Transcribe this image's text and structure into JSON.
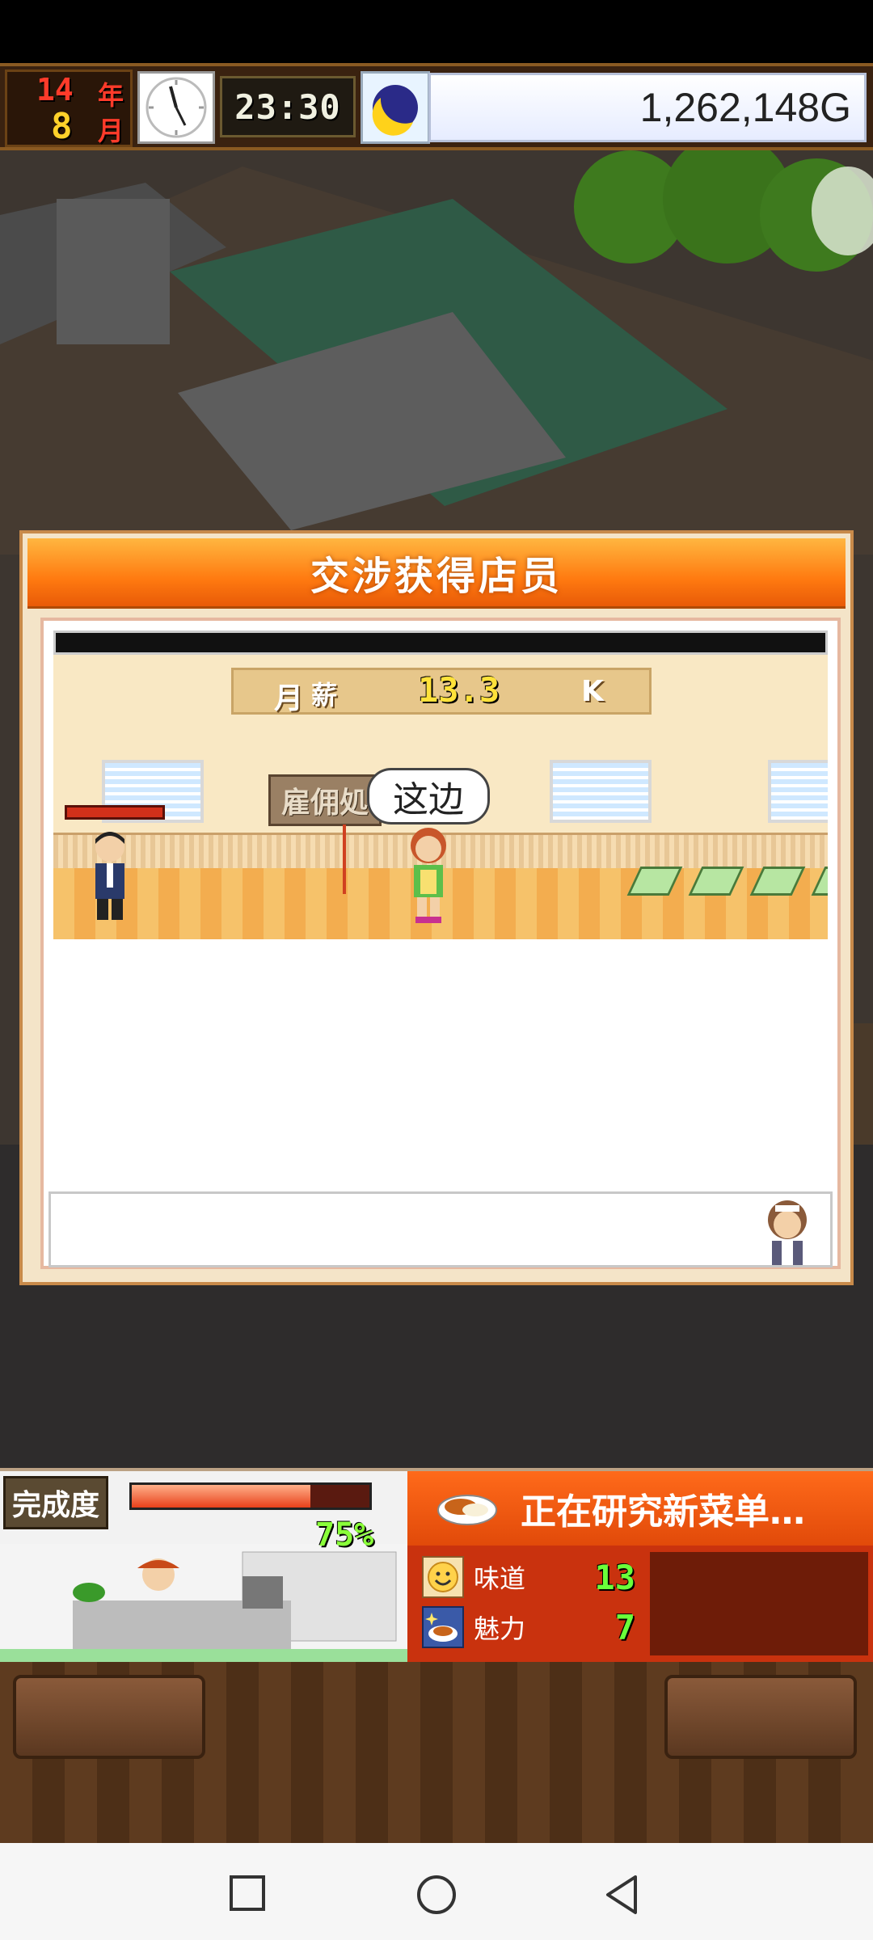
{
  "hud": {
    "year_num": "14",
    "year_unit": "年",
    "month_num": "8",
    "month_unit": "月",
    "time": "23:30",
    "money": "1,262,148G"
  },
  "dialog": {
    "title": "交涉获得店员",
    "salary_label_1": "月",
    "salary_label_2": "薪",
    "salary_value": "13.3",
    "salary_unit": "K",
    "sign_text": "雇佣処",
    "bubble_text": "这边"
  },
  "bottom": {
    "progress_label": "完成度",
    "progress_pct": "75%",
    "progress_value": 0.75,
    "research_title": "正在研究新菜单…",
    "stats": [
      {
        "label": "味道",
        "value": "13",
        "icon": "smile-icon"
      },
      {
        "label": "魅力",
        "value": "7",
        "icon": "dish-sparkle-icon"
      }
    ]
  },
  "colors": {
    "accent_orange": "#ff7a10",
    "money_bg": "#e6ecff",
    "stat_green": "#6aff3a"
  },
  "navigation": [
    "recent-apps-icon",
    "home-icon",
    "back-icon"
  ]
}
